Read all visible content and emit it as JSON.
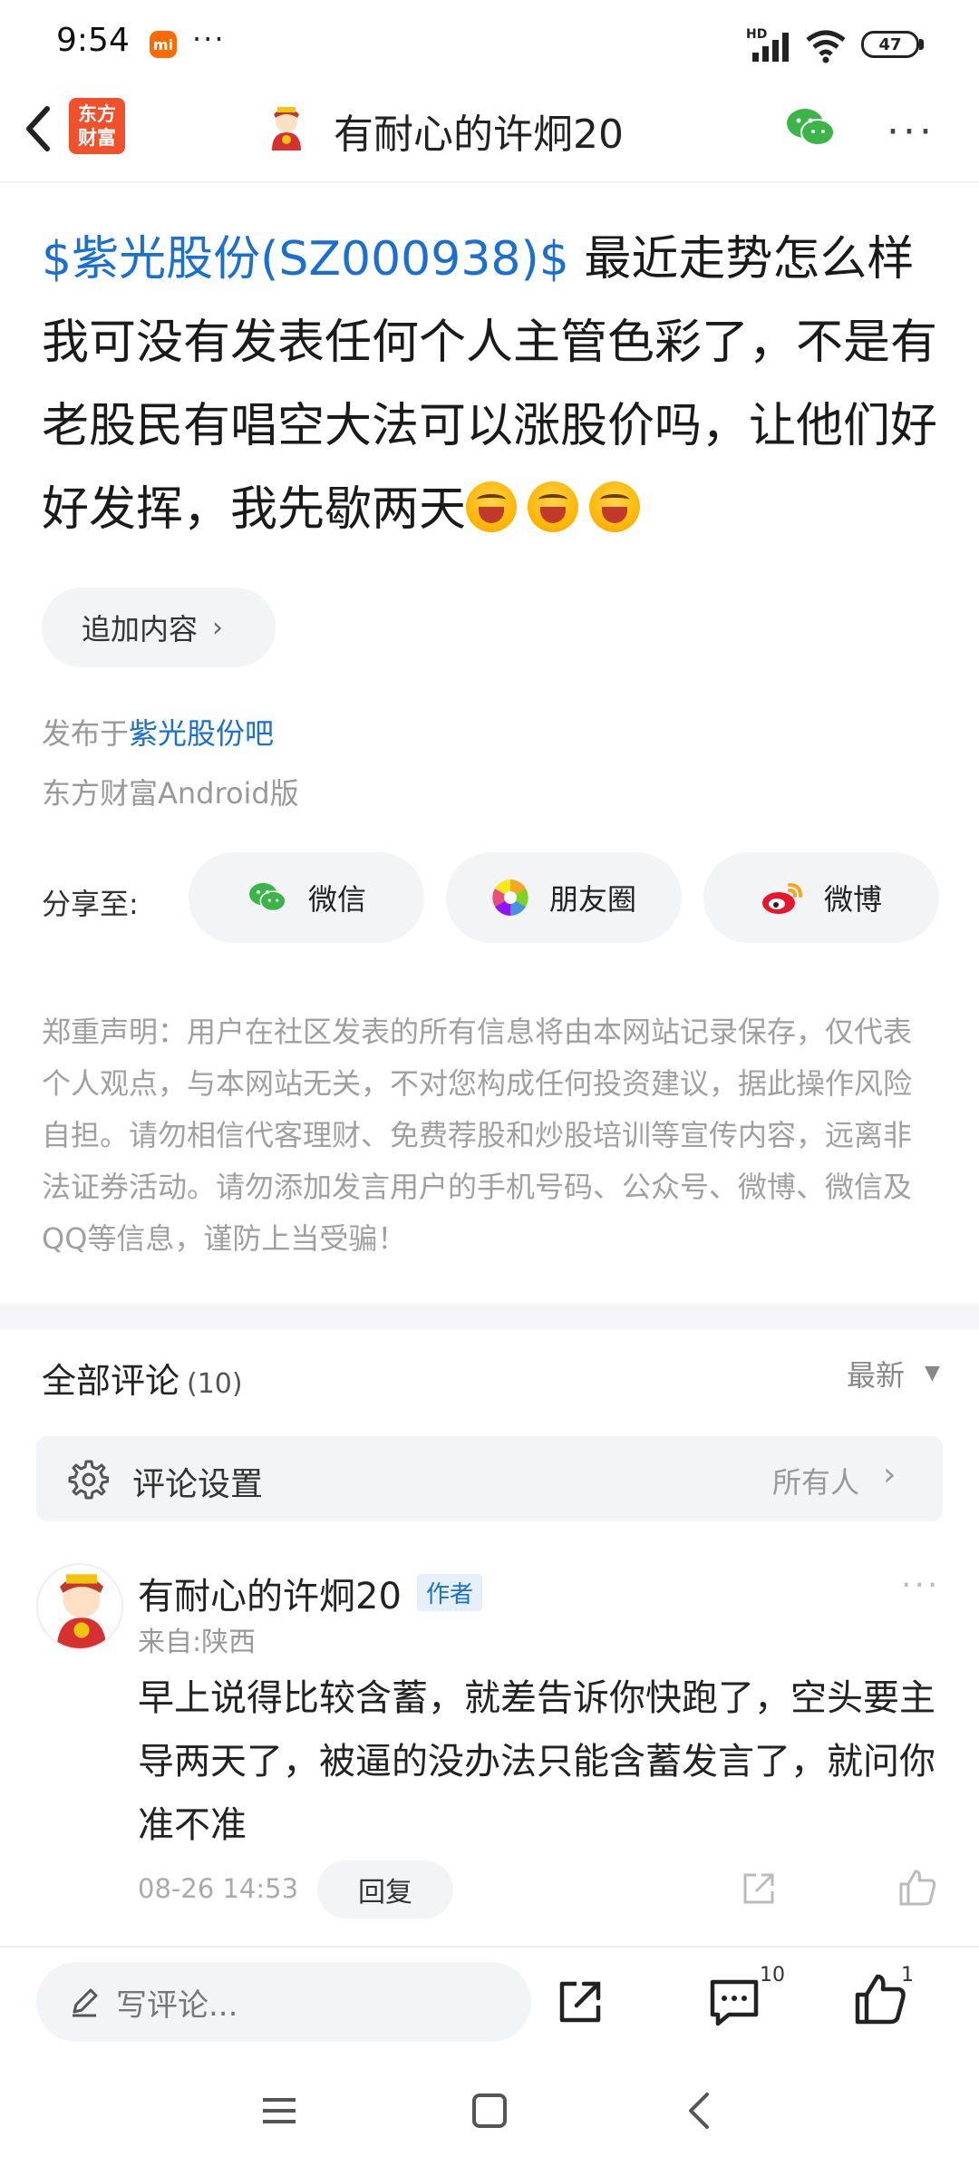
{
  "status_bar": {
    "time": "9:54",
    "mi_label": "mi",
    "dots": "···",
    "network": "HD",
    "battery": "47"
  },
  "header": {
    "logo_line1": "东方",
    "logo_line2": "财富",
    "title": "有耐心的许炯20",
    "colors": {
      "logo_bg": "#f0502a",
      "wechat": "#3bb54a"
    }
  },
  "post": {
    "stock_tag": "$紫光股份(SZ000938)$",
    "text": " 最近走势怎么样我可没有发表任何个人主管色彩了，不是有老股民有唱空大法可以涨股价吗，让他们好好发挥，我先歇两天",
    "emoji_icon": "laughing-face-icon",
    "append_label": "追加内容",
    "publish_prefix": "发布于",
    "publish_bar": "紫光股份吧",
    "client": "东方财富Android版"
  },
  "share": {
    "label": "分享至:",
    "wechat": "微信",
    "moments": "朋友圈",
    "weibo": "微博"
  },
  "disclaimer": "郑重声明：用户在社区发表的所有信息将由本网站记录保存，仅代表个人观点，与本网站无关，不对您构成任何投资建议，据此操作风险自担。请勿相信代客理财、免费荐股和炒股培训等宣传内容，远离非法证券活动。请勿添加发言用户的手机号码、公众号、微博、微信及QQ等信息，谨防上当受骗！",
  "comments": {
    "title": "全部评论",
    "count": "(10)",
    "sort": "最新",
    "settings_label": "评论设置",
    "settings_value": "所有人",
    "items": [
      {
        "username": "有耐心的许炯20",
        "badge": "作者",
        "location": "来自:陕西",
        "text": "早上说得比较含蓄，就差告诉你快跑了，空头要主导两天了，被逼的没办法只能含蓄发言了，就问你准不准",
        "time": "08-26 14:53",
        "reply_label": "回复"
      }
    ]
  },
  "bottom_bar": {
    "placeholder": "写评论...",
    "comment_count": "10",
    "like_count": "1"
  }
}
